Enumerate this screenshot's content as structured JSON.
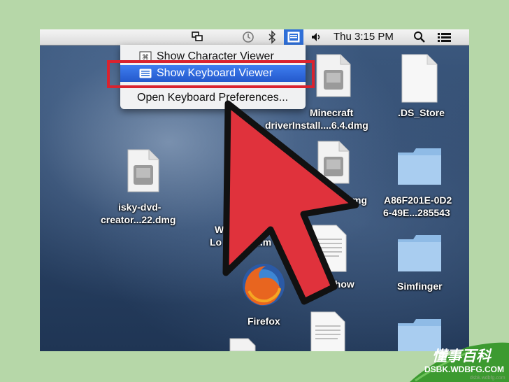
{
  "menubar": {
    "clock": "Thu 3:15 PM",
    "icons": [
      "display-mirroring-icon",
      "time-machine-icon",
      "bluetooth-icon",
      "input-menu-icon",
      "volume-icon",
      "spotlight-icon",
      "notification-list-icon"
    ]
  },
  "input_menu": {
    "items": [
      {
        "label": "Show Character Viewer"
      },
      {
        "label": "Show Keyboard Viewer",
        "selected": true
      },
      {
        "label": "Open Keyboard Preferences..."
      }
    ]
  },
  "desktop": {
    "files": [
      {
        "label": "Minecraft"
      },
      {
        "label": "driverInstall....6.4.dmg"
      },
      {
        "label": ".DS_Store"
      },
      {
        "label": "isky-dvd-"
      },
      {
        "label": "creator...22.dmg"
      },
      {
        "label": "mg"
      },
      {
        "label": "A86F201E-0D2"
      },
      {
        "label": "6-49E...285543"
      },
      {
        "label": "W"
      },
      {
        "label": "Lo"
      },
      {
        "label": "l.m"
      },
      {
        "label": "show"
      },
      {
        "label": "Simfinger"
      },
      {
        "label": "Firefox"
      }
    ]
  },
  "watermark": {
    "title": "懂事百科",
    "url": "DSBK.WDBFG.COM",
    "small": "dsbk.wdbfg.com"
  },
  "colors": {
    "highlight_box": "#d9232f",
    "arrow_fill": "#e0323c",
    "selection": "#2f6fd8",
    "frame_bg": "#b6d7a8"
  }
}
